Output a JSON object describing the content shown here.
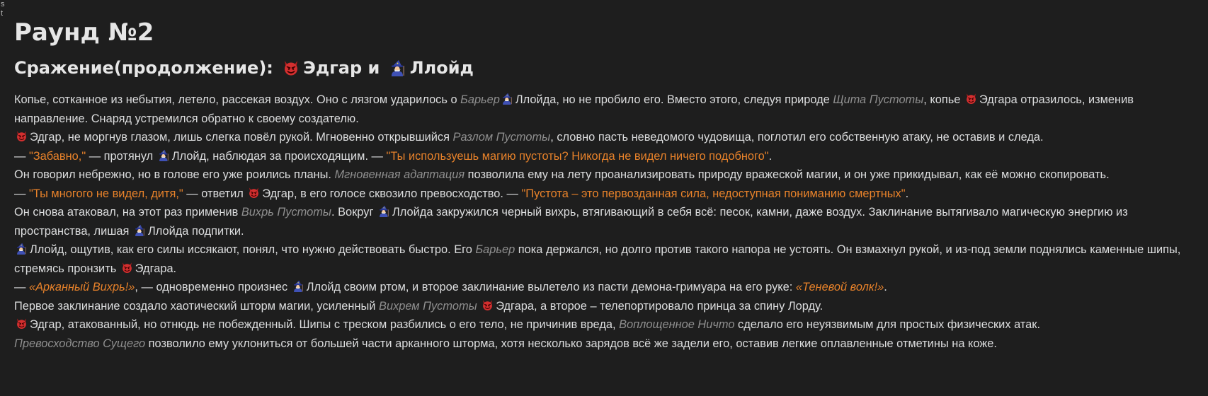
{
  "corner_text": [
    "s",
    "t"
  ],
  "title": "Раунд №2",
  "subtitle": {
    "prefix": "Сражение(продолжение): ",
    "name1": "Эдгар",
    "and": " и ",
    "name2": "Ллойд"
  },
  "icons": {
    "devil": "devil-emoji-icon",
    "wizard": "mage-emoji-icon"
  },
  "paragraphs": [
    [
      {
        "t": "text",
        "v": "Копье, сотканное из небытия, летело, рассекая воздух. Оно с лязгом ударилось о "
      },
      {
        "t": "term",
        "v": "Барьер"
      },
      {
        "t": "wizard"
      },
      {
        "t": "text",
        "v": "Ллойда, но не пробило его. Вместо этого, следуя природе "
      },
      {
        "t": "term",
        "v": "Щита Пустоты"
      },
      {
        "t": "text",
        "v": ", копье "
      },
      {
        "t": "devil"
      },
      {
        "t": "text",
        "v": "Эдгара отразилось, изменив направление. Снаряд устремился обратно к своему создателю."
      }
    ],
    [
      {
        "t": "devil"
      },
      {
        "t": "text",
        "v": "Эдгар, не моргнув глазом, лишь слегка повёл рукой. Мгновенно открывшийся "
      },
      {
        "t": "term",
        "v": "Разлом Пустоты"
      },
      {
        "t": "text",
        "v": ", словно пасть неведомого чудовища, поглотил его собственную атаку, не оставив и следа."
      }
    ],
    [
      {
        "t": "text",
        "v": "— "
      },
      {
        "t": "speech",
        "v": "\"Забавно,\""
      },
      {
        "t": "text",
        "v": " — протянул "
      },
      {
        "t": "wizard"
      },
      {
        "t": "text",
        "v": "Ллойд, наблюдая за происходящим. — "
      },
      {
        "t": "speech",
        "v": "\"Ты используешь магию пустоты? Никогда не видел ничего подобного\""
      },
      {
        "t": "text",
        "v": "."
      }
    ],
    [
      {
        "t": "text",
        "v": "Он говорил небрежно, но в голове его уже роились планы. "
      },
      {
        "t": "term",
        "v": "Мгновенная адаптация"
      },
      {
        "t": "text",
        "v": " позволила ему на лету проанализировать природу вражеской магии, и он уже прикидывал, как её можно скопировать."
      }
    ],
    [
      {
        "t": "text",
        "v": "— "
      },
      {
        "t": "speech",
        "v": "\"Ты многого не видел, дитя,\""
      },
      {
        "t": "text",
        "v": " — ответил "
      },
      {
        "t": "devil"
      },
      {
        "t": "text",
        "v": "Эдгар, в его голосе сквозило превосходство. — "
      },
      {
        "t": "speech",
        "v": "\"Пустота – это первозданная сила, недоступная пониманию смертных\""
      },
      {
        "t": "text",
        "v": "."
      }
    ],
    [
      {
        "t": "text",
        "v": "Он снова атаковал, на этот раз применив "
      },
      {
        "t": "term",
        "v": "Вихрь Пустоты"
      },
      {
        "t": "text",
        "v": ". Вокруг "
      },
      {
        "t": "wizard"
      },
      {
        "t": "text",
        "v": "Ллойда закружился черный вихрь, втягивающий в себя всё: песок, камни, даже воздух. Заклинание вытягивало магическую энергию из пространства, лишая "
      },
      {
        "t": "wizard"
      },
      {
        "t": "text",
        "v": "Ллойда подпитки."
      }
    ],
    [
      {
        "t": "wizard"
      },
      {
        "t": "text",
        "v": "Ллойд, ощутив, как его силы иссякают, понял, что нужно действовать быстро. Его "
      },
      {
        "t": "term",
        "v": "Барьер"
      },
      {
        "t": "text",
        "v": " пока держался, но долго против такого напора не устоять. Он взмахнул рукой, и из-под земли поднялись каменные шипы, стремясь пронзить "
      },
      {
        "t": "devil"
      },
      {
        "t": "text",
        "v": "Эдгара."
      }
    ],
    [
      {
        "t": "text",
        "v": "— "
      },
      {
        "t": "spell",
        "v": "«Арканный Вихрь!»"
      },
      {
        "t": "text",
        "v": ", — одновременно произнес "
      },
      {
        "t": "wizard"
      },
      {
        "t": "text",
        "v": "Ллойд своим ртом, и второе заклинание вылетело из пасти демона-гримуара на его руке: "
      },
      {
        "t": "spell",
        "v": "«Теневой волк!»"
      },
      {
        "t": "text",
        "v": "."
      }
    ],
    [
      {
        "t": "text",
        "v": "Первое заклинание создало хаотический шторм магии, усиленный "
      },
      {
        "t": "term",
        "v": "Вихрем Пустоты"
      },
      {
        "t": "text",
        "v": " "
      },
      {
        "t": "devil"
      },
      {
        "t": "text",
        "v": "Эдгара, а второе – телепортировало принца за спину Лорду."
      }
    ],
    [
      {
        "t": "devil"
      },
      {
        "t": "text",
        "v": "Эдгар, атакованный, но отнюдь не побежденный. Шипы с треском разбились о его тело, не причинив вреда, "
      },
      {
        "t": "term",
        "v": "Воплощенное Ничто"
      },
      {
        "t": "text",
        "v": " сделало его неуязвимым для простых физических атак."
      }
    ],
    [
      {
        "t": "term",
        "v": "Превосходство Сущего"
      },
      {
        "t": "text",
        "v": " позволило ему уклониться от большей части арканного шторма, хотя несколько зарядов всё же задели его, оставив легкие оплавленные отметины на коже."
      }
    ]
  ]
}
